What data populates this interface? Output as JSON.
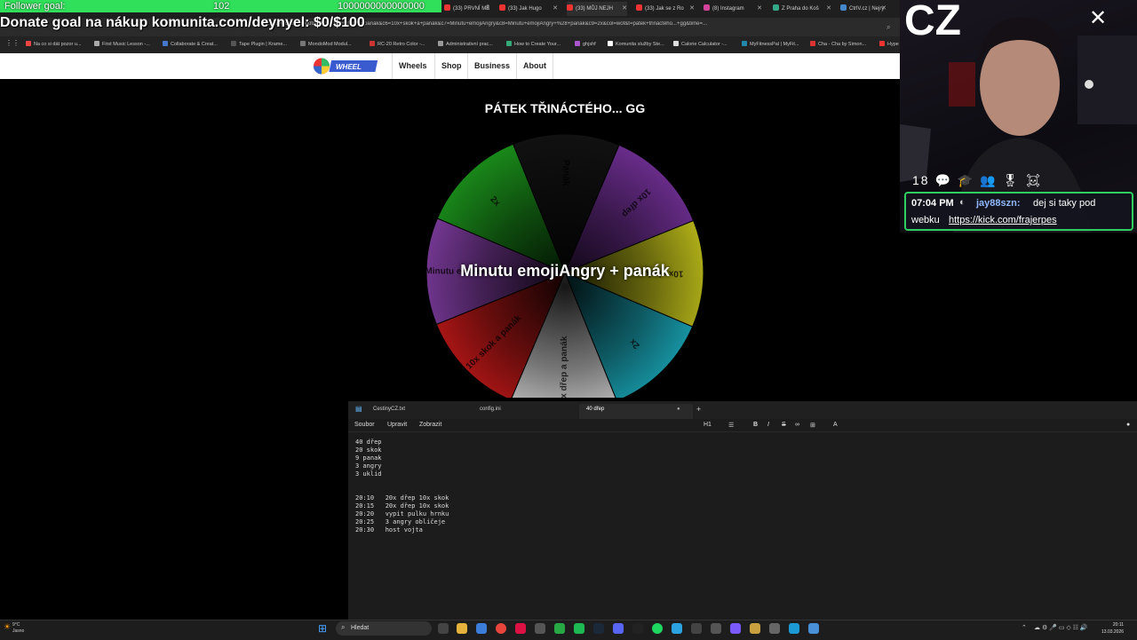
{
  "overlay": {
    "follower_label": "Follower goal:",
    "follower_count": "102",
    "follower_target": "1000000000000000",
    "donate_text": "Donate goal na nákup komunita.com/deynyel: $0/$100"
  },
  "browser": {
    "tabs": [
      {
        "label": "(33) PRVNÍ MĚ",
        "color": "#e33"
      },
      {
        "label": "(33) Jak Hugo",
        "color": "#e33"
      },
      {
        "label": "(33) MŮJ NEJH",
        "color": "#e33"
      },
      {
        "label": "(33) Jak se z Ro",
        "color": "#e33"
      },
      {
        "label": "(8) Instagram",
        "color": "#d4449c"
      },
      {
        "label": "Z Praha do Koš",
        "color": "#3a8"
      },
      {
        "label": "CtrlV.cz | Nejry",
        "color": "#48c"
      },
      {
        "label": "Hype",
        "color": "#e33"
      }
    ],
    "url": "...ulia+kováč+hoodtrap&c5=10x+dřep+a+panák&c6=10x+skok+a+panák&c7=Minutu+emojiAngry&c8=Minutu+emojiAngry+%28+panák&c9=2x&col=wof&t=pátek+třináctého...+gg&time=...",
    "bookmarks": [
      "Na co si dát pozor u...",
      "First Music Lesson -...",
      "Collaborate & Creat...",
      "Tape Plugin | Krame...",
      "MondoMod Modul...",
      "RC-20 Retro Color -...",
      "Administrativní prac...",
      "How to Create Your...",
      "ghjshf",
      "Komunita služby Ste...",
      "Calorie Calculator -...",
      "MyFitnessPal | MyFit...",
      "Cha - Cha by Simon..."
    ]
  },
  "site": {
    "nav": [
      "Wheels",
      "Shop",
      "Business",
      "About"
    ],
    "wheel_title": "PÁTEK TŘINÁCTÉHO... GG",
    "wheel_result": "Minutu emojiAngry + panák",
    "segments": [
      {
        "label": "Panák",
        "color": "#111111"
      },
      {
        "label": "10x dřep",
        "color": "#6a2d8c"
      },
      {
        "label": "10x skok",
        "color": "#b9b81a"
      },
      {
        "label": "2x",
        "color": "#1aa7b8"
      },
      {
        "label": "10x dřep a panák",
        "color": "#d8d8d8"
      },
      {
        "label": "10x skok a panák",
        "color": "#c01818"
      },
      {
        "label": "Minutu emojiAngry",
        "color": "#7a3a9a"
      },
      {
        "label": "2x",
        "color": "#1a8a1a"
      }
    ]
  },
  "stream": {
    "channel_logo": "CZ",
    "badges": "18 💬 🎓 👥 🎖 ☠",
    "chat": {
      "time": "07:04 PM",
      "user": "jay88szn:",
      "message": "dej si taky pod",
      "message2": "webku",
      "link": "https://kick.com/frajerpes"
    }
  },
  "notepad": {
    "tabs": [
      "CestinyCZ.txt",
      "config.ini",
      "40 dřep"
    ],
    "menu": [
      "Soubor",
      "Upravit",
      "Zobrazit"
    ],
    "format_tools": "H1",
    "lines": [
      "40 dřep",
      "20 skok",
      "9 panak",
      "3 angry",
      "3 uklid",
      "",
      "",
      "20:10   20x dřep 10x skok",
      "20:15   20x dřep 10x skok",
      "20:20   vypit pulku hrnku",
      "20:25   3 angry obličeje",
      "20:30   host vojta"
    ]
  },
  "taskbar": {
    "weather_temp": "9°C",
    "weather_desc": "Jasno",
    "search_label": "Hledat",
    "time": "20:11",
    "date": "13.03.2026"
  }
}
